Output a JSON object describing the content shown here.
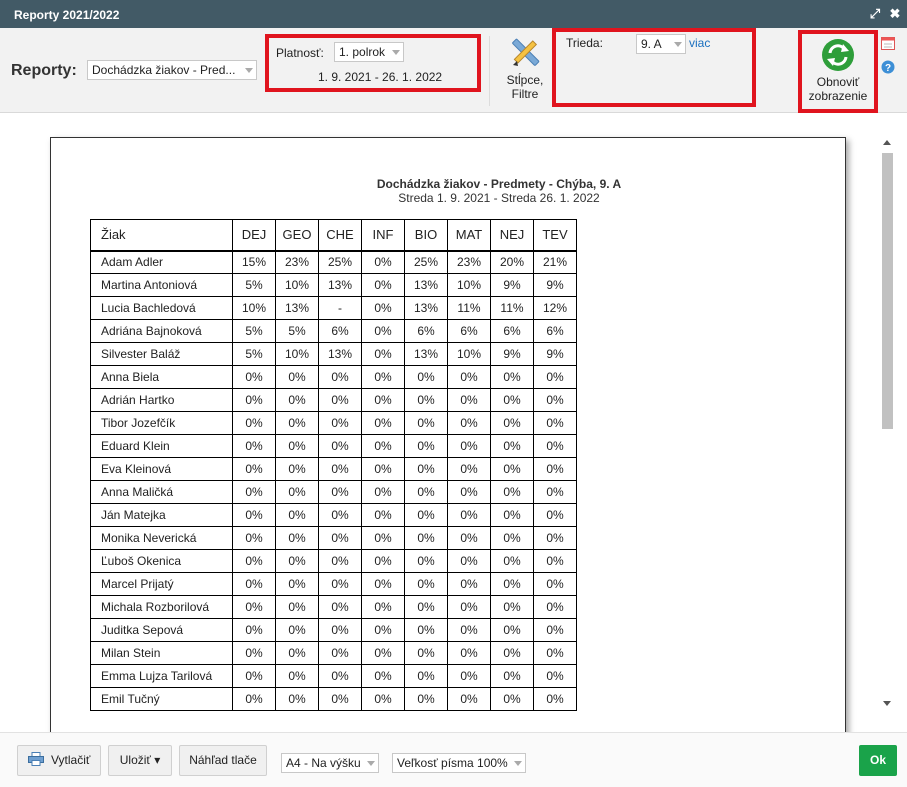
{
  "window": {
    "title": "Reporty 2021/2022"
  },
  "toolbar": {
    "reports_label": "Reporty:",
    "report_select": "Dochádzka žiakov - Pred...",
    "validity_label": "Platnosť:",
    "validity_select": "1. polrok",
    "validity_range": "1. 9. 2021 - 26. 1. 2022",
    "columns_filters_line1": "Stĺpce,",
    "columns_filters_line2": "Filtre",
    "class_label": "Trieda:",
    "class_select": "9. A",
    "more_link": "viac",
    "refresh_line1": "Obnoviť",
    "refresh_line2": "zobrazenie"
  },
  "report": {
    "title": "Dochádzka žiakov - Predmety - Chýba, 9. A",
    "subtitle": "Streda 1. 9. 2021 - Streda 26. 1. 2022",
    "columns": [
      "Žiak",
      "DEJ",
      "GEO",
      "CHE",
      "INF",
      "BIO",
      "MAT",
      "NEJ",
      "TEV"
    ],
    "rows": [
      [
        "Adam Adler",
        "15%",
        "23%",
        "25%",
        "0%",
        "25%",
        "23%",
        "20%",
        "21%"
      ],
      [
        "Martina Antoniová",
        "5%",
        "10%",
        "13%",
        "0%",
        "13%",
        "10%",
        "9%",
        "9%"
      ],
      [
        "Lucia Bachledová",
        "10%",
        "13%",
        "-",
        "0%",
        "13%",
        "11%",
        "11%",
        "12%"
      ],
      [
        "Adriána Bajnoková",
        "5%",
        "5%",
        "6%",
        "0%",
        "6%",
        "6%",
        "6%",
        "6%"
      ],
      [
        "Silvester Baláž",
        "5%",
        "10%",
        "13%",
        "0%",
        "13%",
        "10%",
        "9%",
        "9%"
      ],
      [
        "Anna Biela",
        "0%",
        "0%",
        "0%",
        "0%",
        "0%",
        "0%",
        "0%",
        "0%"
      ],
      [
        "Adrián Hartko",
        "0%",
        "0%",
        "0%",
        "0%",
        "0%",
        "0%",
        "0%",
        "0%"
      ],
      [
        "Tibor Jozefčík",
        "0%",
        "0%",
        "0%",
        "0%",
        "0%",
        "0%",
        "0%",
        "0%"
      ],
      [
        "Eduard Klein",
        "0%",
        "0%",
        "0%",
        "0%",
        "0%",
        "0%",
        "0%",
        "0%"
      ],
      [
        "Eva Kleinová",
        "0%",
        "0%",
        "0%",
        "0%",
        "0%",
        "0%",
        "0%",
        "0%"
      ],
      [
        "Anna Maličká",
        "0%",
        "0%",
        "0%",
        "0%",
        "0%",
        "0%",
        "0%",
        "0%"
      ],
      [
        "Ján Matejka",
        "0%",
        "0%",
        "0%",
        "0%",
        "0%",
        "0%",
        "0%",
        "0%"
      ],
      [
        "Monika Neverická",
        "0%",
        "0%",
        "0%",
        "0%",
        "0%",
        "0%",
        "0%",
        "0%"
      ],
      [
        "Ľuboš Okenica",
        "0%",
        "0%",
        "0%",
        "0%",
        "0%",
        "0%",
        "0%",
        "0%"
      ],
      [
        "Marcel Prijatý",
        "0%",
        "0%",
        "0%",
        "0%",
        "0%",
        "0%",
        "0%",
        "0%"
      ],
      [
        "Michala Rozborilová",
        "0%",
        "0%",
        "0%",
        "0%",
        "0%",
        "0%",
        "0%",
        "0%"
      ],
      [
        "Juditka Sepová",
        "0%",
        "0%",
        "0%",
        "0%",
        "0%",
        "0%",
        "0%",
        "0%"
      ],
      [
        "Milan Stein",
        "0%",
        "0%",
        "0%",
        "0%",
        "0%",
        "0%",
        "0%",
        "0%"
      ],
      [
        "Emma Lujza Tarilová",
        "0%",
        "0%",
        "0%",
        "0%",
        "0%",
        "0%",
        "0%",
        "0%"
      ],
      [
        "Emil Tučný",
        "0%",
        "0%",
        "0%",
        "0%",
        "0%",
        "0%",
        "0%",
        "0%"
      ]
    ]
  },
  "footer": {
    "print": "Vytlačiť",
    "save": "Uložiť ▾",
    "preview": "Náhľad tlače",
    "page_format": "A4 - Na výšku",
    "font_size": "Veľkosť písma 100%",
    "ok": "Ok"
  },
  "icons": {
    "maximize": "maximize-icon",
    "close": "close-icon",
    "columns_filters": "pencil-ruler-icon",
    "refresh": "refresh-icon",
    "calendar": "calendar-icon",
    "help": "help-icon",
    "printer": "printer-icon"
  },
  "colors": {
    "titlebar": "#425a66",
    "highlight": "#e0141e",
    "link": "#1a6fbf",
    "ok_button": "#1aa34a",
    "refresh_icon": "#2e9e3a"
  }
}
